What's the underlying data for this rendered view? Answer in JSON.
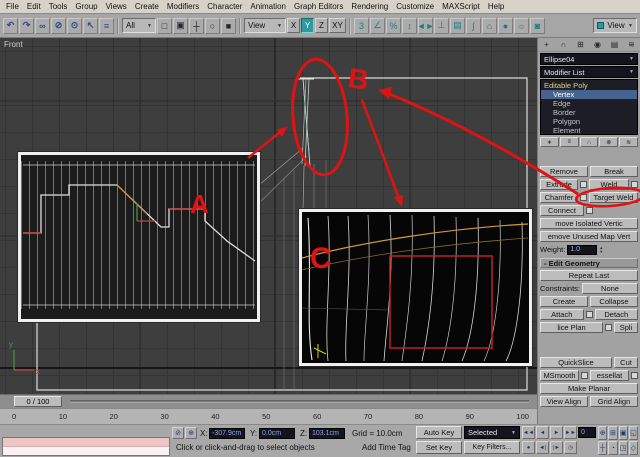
{
  "menu": {
    "items": [
      "File",
      "Edit",
      "Tools",
      "Group",
      "Views",
      "Create",
      "Modifiers",
      "Character",
      "Animation",
      "Graph Editors",
      "Rendering",
      "Customize",
      "MAXScript",
      "Help"
    ]
  },
  "toolbar": {
    "select_filter": "All",
    "ref_coord": "View",
    "view_button": "View",
    "axis": {
      "x": "X",
      "y": "Y",
      "z": "Z",
      "xy": "XY"
    },
    "icons_left": [
      {
        "name": "undo-icon",
        "glyph": "↶"
      },
      {
        "name": "redo-icon",
        "glyph": "↷"
      },
      {
        "name": "select-link-icon",
        "glyph": "∞"
      },
      {
        "name": "unlink-selection-icon",
        "glyph": "⊘"
      },
      {
        "name": "bind-to-spacewarp-icon",
        "glyph": "⊙"
      },
      {
        "name": "select-object-icon",
        "glyph": "↖"
      },
      {
        "name": "select-by-name-icon",
        "glyph": "≡"
      }
    ],
    "icons_mid": [
      {
        "name": "rectangular-region-icon",
        "glyph": "□"
      },
      {
        "name": "window-crossing-icon",
        "glyph": "▣"
      },
      {
        "name": "select-move-icon",
        "glyph": "┼"
      },
      {
        "name": "select-rotate-icon",
        "glyph": "○"
      },
      {
        "name": "select-scale-icon",
        "glyph": "■"
      }
    ],
    "icons_right": [
      {
        "name": "snaps-toggle-icon",
        "glyph": "3"
      },
      {
        "name": "angle-snap-icon",
        "glyph": "∠"
      },
      {
        "name": "percent-snap-icon",
        "glyph": "%"
      },
      {
        "name": "spinner-snap-icon",
        "glyph": "↕"
      },
      {
        "name": "mirror-icon",
        "glyph": "◄►"
      },
      {
        "name": "align-icon",
        "glyph": "⊥"
      },
      {
        "name": "layer-manager-icon",
        "glyph": "▤"
      },
      {
        "name": "curve-editor-icon",
        "glyph": "∫"
      },
      {
        "name": "schematic-view-icon",
        "glyph": "⌂"
      },
      {
        "name": "material-editor-icon",
        "glyph": "●"
      },
      {
        "name": "render-setup-icon",
        "glyph": "☼"
      },
      {
        "name": "quick-render-icon",
        "glyph": "◙"
      }
    ]
  },
  "viewport": {
    "label": "Front",
    "axis_x_label": "x",
    "axis_y_label": "y"
  },
  "command_panel": {
    "tabs": [
      {
        "name": "tab-create-icon",
        "glyph": "+"
      },
      {
        "name": "tab-modify-icon",
        "glyph": "∩"
      },
      {
        "name": "tab-hierarchy-icon",
        "glyph": "⊞"
      },
      {
        "name": "tab-motion-icon",
        "glyph": "◉"
      },
      {
        "name": "tab-display-icon",
        "glyph": "▤"
      },
      {
        "name": "tab-utilities-icon",
        "glyph": "≋"
      }
    ],
    "object_name": "Ellipse04",
    "modifier_list_label": "Modifier List",
    "stack": {
      "root": "Editable Poly",
      "items": [
        "Vertex",
        "Edge",
        "Border",
        "Polygon",
        "Element"
      ]
    },
    "stack_tools": [
      {
        "name": "pin-stack-icon",
        "glyph": "∗"
      },
      {
        "name": "show-end-result-icon",
        "glyph": "≡"
      },
      {
        "name": "make-unique-icon",
        "glyph": "∴"
      },
      {
        "name": "remove-modifier-icon",
        "glyph": "⊗"
      },
      {
        "name": "configure-modifier-sets-icon",
        "glyph": "≋"
      }
    ],
    "edit_vertices": {
      "remove": "Remove",
      "break": "Break",
      "extrude": "Extrude",
      "weld": "Weld",
      "chamfer": "Chamfer",
      "target_weld": "Target Weld",
      "connect": "Connect",
      "remove_isolated": "move Isolated Vertic",
      "remove_unused": "emove Unused Map Vert",
      "weight_label": "Weight:",
      "weight_value": "1.0"
    },
    "edit_geometry": {
      "header": "-  Edit Geometry",
      "repeat_last": "Repeat Last",
      "constraints_label": "Constraints:",
      "constraints_value": "None",
      "create": "Create",
      "collapse": "Collapse",
      "attach": "Attach",
      "detach": "Detach",
      "slice_plane": "lice Plan",
      "split": "Spli",
      "quickslice": "QuickSlice",
      "cut": "Cut",
      "msmooth": "MSmooth",
      "tessellate": "essellat",
      "make_planar": "Make Planar",
      "view_align": "View Align",
      "grid_align": "Grid Align"
    }
  },
  "timeline": {
    "slider_label": "0 / 100",
    "ticks": [
      "0",
      "10",
      "20",
      "30",
      "40",
      "50",
      "60",
      "70",
      "80",
      "90",
      "100"
    ]
  },
  "status": {
    "x_label": "X:",
    "x_value": "-307.9cm",
    "y_label": "Y:",
    "y_value": "0.0cm",
    "z_label": "Z:",
    "z_value": "103.1cm",
    "grid": "Grid = 10.0cm",
    "prompt": "Click or click-and-drag to select objects",
    "add_time_tag": "Add Time Tag",
    "auto_key": "Auto Key",
    "selected_set": "Selected",
    "set_key": "Set Key",
    "key_filters": "Key Filters...",
    "frame": "0",
    "status_icons": [
      {
        "name": "selection-lock-toggle-icon",
        "glyph": "⊘"
      },
      {
        "name": "absolute-offset-toggle-icon",
        "glyph": "⊕"
      }
    ]
  },
  "playback": {
    "row1": [
      {
        "name": "go-to-start-icon",
        "glyph": "◄◄"
      },
      {
        "name": "previous-frame-icon",
        "glyph": "◄"
      },
      {
        "name": "play-icon",
        "glyph": "►"
      },
      {
        "name": "go-to-end-icon",
        "glyph": "►►"
      }
    ],
    "row2": [
      {
        "name": "key-mode-toggle-icon",
        "glyph": "●"
      },
      {
        "name": "previous-key-icon",
        "glyph": "◄|"
      },
      {
        "name": "next-key-icon",
        "glyph": "|►"
      },
      {
        "name": "time-configuration-icon",
        "glyph": "◷"
      }
    ]
  },
  "nav": [
    {
      "name": "zoom-icon",
      "glyph": "⊕"
    },
    {
      "name": "zoom-all-icon",
      "glyph": "⊞"
    },
    {
      "name": "zoom-extents-icon",
      "glyph": "▣"
    },
    {
      "name": "zoom-region-icon",
      "glyph": "◱"
    },
    {
      "name": "pan-icon",
      "glyph": "┼"
    },
    {
      "name": "arc-rotate-icon",
      "glyph": "◔"
    },
    {
      "name": "min-max-toggle-icon",
      "glyph": "◳"
    },
    {
      "name": "field-of-view-icon",
      "glyph": "◇"
    }
  ],
  "annotations": {
    "label_a": "A",
    "label_b": "B",
    "label_c": "C"
  },
  "ui": {
    "dropdown_arrow": "▼",
    "spin_up": "▲",
    "spin_down": "▼"
  },
  "colors": {
    "annotation_red": "#e01212",
    "accent_teal": "#2e9aa0",
    "viewport_bg": "#3e3e3e"
  }
}
